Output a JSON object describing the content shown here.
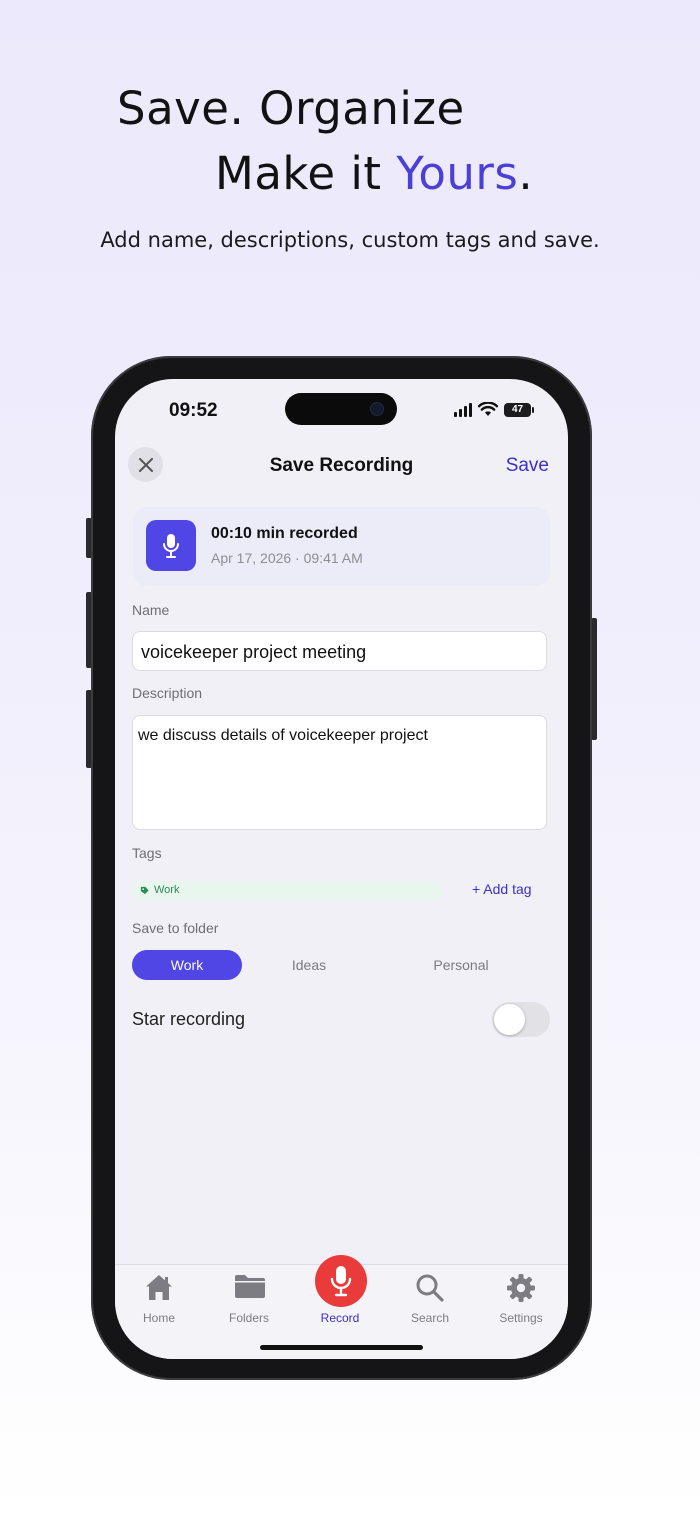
{
  "headline": {
    "line1": "Save. Organize",
    "line2_prefix": "Make it ",
    "line2_accent": "Yours",
    "line2_suffix": ".",
    "subtitle": "Add name, descriptions, custom tags and save."
  },
  "status_bar": {
    "time": "09:52",
    "battery": "47"
  },
  "nav": {
    "title": "Save Recording",
    "save_label": "Save",
    "close_icon": "close-icon"
  },
  "recording": {
    "title": "00:10 min recorded",
    "date": "Apr 17, 2026 · 09:41 AM",
    "icon": "microphone-icon"
  },
  "form": {
    "name_label": "Name",
    "name_value": "voicekeeper project meeting",
    "description_label": "Description",
    "description_value": "we discuss details of voicekeeper project",
    "tags_label": "Tags",
    "tags": [
      "Work"
    ],
    "add_tag_label": "+ Add tag",
    "folder_label": "Save to folder",
    "folders": [
      {
        "label": "Work",
        "selected": true
      },
      {
        "label": "Ideas",
        "selected": false
      },
      {
        "label": "Personal",
        "selected": false
      }
    ],
    "star_label": "Star recording",
    "star_enabled": false
  },
  "tabbar": {
    "items": [
      {
        "label": "Home",
        "icon": "home-icon",
        "active": false
      },
      {
        "label": "Folders",
        "icon": "folder-icon",
        "active": false
      },
      {
        "label": "Record",
        "icon": "microphone-icon",
        "active": true
      },
      {
        "label": "Search",
        "icon": "search-icon",
        "active": false
      },
      {
        "label": "Settings",
        "icon": "gear-icon",
        "active": false
      }
    ]
  },
  "colors": {
    "accent": "#4f46e5",
    "accent_text": "#3b30c8",
    "record": "#ea3b3b",
    "tag_green": "#2e8b57",
    "headline_accent": "#4a3fd6"
  }
}
